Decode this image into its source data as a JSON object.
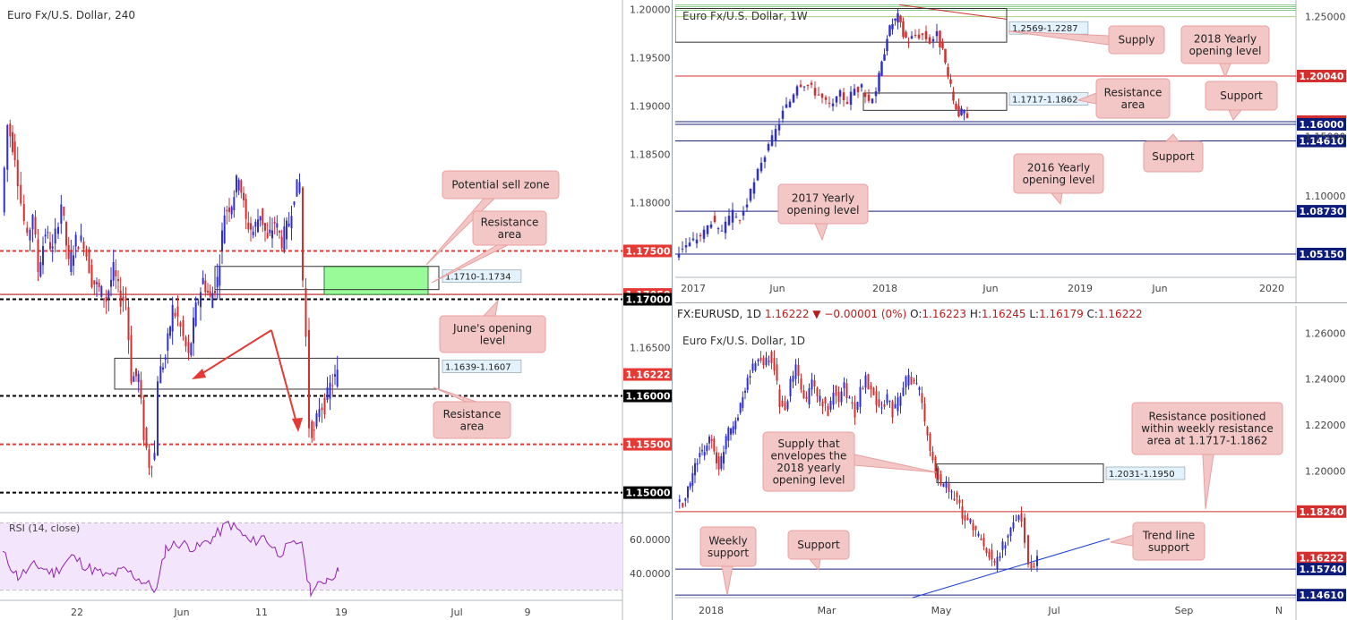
{
  "chart_data": [
    {
      "id": "h4",
      "type": "candlestick",
      "title": "Euro Fx/U.S. Dollar, 240",
      "x_tick_labels": [
        "22",
        "Jun",
        "11",
        "19",
        "Jul",
        "9"
      ],
      "y_tick_labels": [
        "1.20000",
        "1.19500",
        "1.19000",
        "1.18500",
        "1.18000",
        "1.17500",
        "1.17000",
        "1.16500",
        "1.16000",
        "1.15500",
        "1.15000"
      ],
      "ylim": [
        1.1495,
        1.2004
      ],
      "levels": [
        {
          "price": 1.175,
          "label": "1.17500",
          "style": "dashed",
          "color": "#e53935"
        },
        {
          "price": 1.1705,
          "label": "1.17050",
          "style": "solid",
          "color": "#b71c1c"
        },
        {
          "price": 1.17,
          "label": "1.17000",
          "style": "dashed",
          "color": "#000000"
        },
        {
          "price": 1.16,
          "label": "1.16000",
          "style": "dashed",
          "color": "#000000"
        },
        {
          "price": 1.155,
          "label": "1.15500",
          "style": "dashed",
          "color": "#e53935"
        },
        {
          "price": 1.15,
          "label": "1.15000",
          "style": "dashed",
          "color": "#000000"
        }
      ],
      "last_price": {
        "price": 1.16222,
        "label": "1.16222"
      },
      "zones": [
        {
          "label": "1.1710-1.1734",
          "high": 1.1734,
          "low": 1.171
        },
        {
          "label": "1.1639-1.1607",
          "high": 1.1639,
          "low": 1.1607
        }
      ],
      "sell_zone": {
        "high": 1.1734,
        "low": 1.1705
      },
      "callouts": [
        {
          "text": [
            "Potential sell zone"
          ]
        },
        {
          "text": [
            "Resistance",
            "area"
          ]
        },
        {
          "text": [
            "June's opening",
            "level"
          ]
        },
        {
          "text": [
            "Resistance",
            "area"
          ]
        }
      ],
      "rsi": {
        "title": "RSI (14, close)",
        "y_tick_labels": [
          "60.0000",
          "40.0000"
        ],
        "ylim": [
          25,
          75
        ],
        "bands": [
          70,
          30
        ]
      }
    },
    {
      "id": "weekly",
      "type": "candlestick",
      "title": "Euro Fx/U.S. Dollar, 1W",
      "x_tick_labels": [
        "2017",
        "Jun",
        "2018",
        "Jun",
        "2019",
        "Jun",
        "2020"
      ],
      "y_tick_labels": [
        "1.25000",
        "1.15000",
        "1.10000"
      ],
      "ylim": [
        1.032,
        1.264
      ],
      "levels": [
        {
          "price": 1.2004,
          "label": "1.20040",
          "color": "#d32f2f",
          "tag_color": "#d32f2f"
        },
        {
          "price": 1.16222,
          "label": "1.16222",
          "color": "#1a237e",
          "tag_color": "#d32f2f"
        },
        {
          "price": 1.16,
          "label": "1.16000",
          "color": "#1a237e",
          "tag_color": "#0d1b7a"
        },
        {
          "price": 1.1461,
          "label": "1.14610",
          "color": "#1a237e",
          "tag_color": "#0d1b7a"
        },
        {
          "price": 1.0873,
          "label": "1.08730",
          "color": "#1a237e",
          "tag_color": "#0d1b7a"
        },
        {
          "price": 1.0515,
          "label": "1.05150",
          "color": "#1a237e",
          "tag_color": "#0d1b7a"
        }
      ],
      "zones": [
        {
          "label": "1.2569-1.2287",
          "high": 1.2569,
          "low": 1.2287
        },
        {
          "label": "1.1717-1.1862",
          "high": 1.1862,
          "low": 1.1717
        }
      ],
      "callouts": [
        {
          "text": [
            "Supply"
          ]
        },
        {
          "text": [
            "2018 Yearly",
            "opening level"
          ]
        },
        {
          "text": [
            "Resistance",
            "area"
          ]
        },
        {
          "text": [
            "Support"
          ]
        },
        {
          "text": [
            "Support"
          ]
        },
        {
          "text": [
            "2016 Yearly",
            "opening level"
          ]
        },
        {
          "text": [
            "2017 Yearly",
            "opening level"
          ]
        }
      ]
    },
    {
      "id": "daily",
      "type": "candlestick",
      "title": "Euro Fx/U.S. Dollar, 1D",
      "x_tick_labels": [
        "2018",
        "Mar",
        "May",
        "Jul",
        "Sep",
        "N"
      ],
      "y_tick_labels": [
        "1.26000",
        "1.24000",
        "1.22000",
        "1.20000"
      ],
      "ylim": [
        1.145,
        1.264
      ],
      "levels": [
        {
          "price": 1.1824,
          "label": "1.18240",
          "color": "#d32f2f",
          "tag_color": "#d32f2f"
        },
        {
          "price": 1.16222,
          "label": "1.16222",
          "color": null,
          "tag_color": "#d32f2f"
        },
        {
          "price": 1.1574,
          "label": "1.15740",
          "color": "#1a237e",
          "tag_color": "#0d1b7a"
        },
        {
          "price": 1.1461,
          "label": "1.14610",
          "color": "#1a237e",
          "tag_color": "#0d1b7a"
        }
      ],
      "zones": [
        {
          "label": "1.2031-1.1950",
          "high": 1.2031,
          "low": 1.195
        }
      ],
      "callouts": [
        {
          "text": [
            "Supply that",
            "envelopes the",
            "2018 yearly",
            "opening level"
          ]
        },
        {
          "text": [
            "Resistance positioned",
            "within weekly resistance",
            "area at 1.1717-1.1862"
          ]
        },
        {
          "text": [
            "Weekly",
            "support"
          ]
        },
        {
          "text": [
            "Support"
          ]
        },
        {
          "text": [
            "Trend line",
            "support"
          ]
        }
      ]
    }
  ],
  "daily_info_bar": {
    "symbol": "FX:EURUSD, 1D",
    "close": "1.16222",
    "arrow": "▼",
    "change": "−0.00001 (0%)",
    "o_label": "O:",
    "o": "1.16223",
    "h_label": "H:",
    "h": "1.16245",
    "l_label": "L:",
    "l": "1.16179",
    "c_label": "C:",
    "c": "1.16222"
  },
  "colors": {
    "bull_candle": "#3030d0",
    "bear_candle": "#d32f2f",
    "sell_zone_fill": "#98fb98",
    "callout_fill": "#f4c7c7",
    "callout_border": "#e8a0a0",
    "rsi_line": "#8e24aa",
    "rsi_bg": "#f3e5fb",
    "box_label_bg": "#e3f2fd"
  }
}
